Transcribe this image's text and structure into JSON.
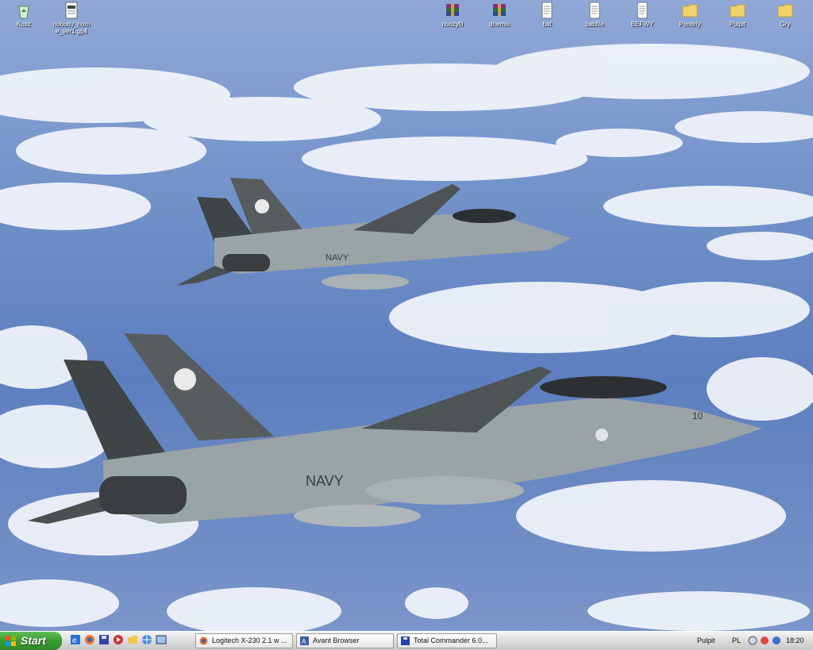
{
  "desktop": {
    "icons_left": [
      {
        "label": "Kosz",
        "icon": "recycle-bin-icon"
      },
      {
        "label": "nobody_hom e_ver1.gp4",
        "icon": "document-icon"
      }
    ],
    "icons_right": [
      {
        "label": "noozyfil",
        "icon": "winrar-archive-icon"
      },
      {
        "label": "dhemis",
        "icon": "winrar-archive-icon"
      },
      {
        "label": "bat",
        "icon": "text-file-icon"
      },
      {
        "label": "babfile",
        "icon": "text-file-icon"
      },
      {
        "label": "BEFWY",
        "icon": "text-file-icon"
      },
      {
        "label": "Pendrly",
        "icon": "folder-icon"
      },
      {
        "label": "Pulpit",
        "icon": "folder-icon"
      },
      {
        "label": "Gry",
        "icon": "folder-icon"
      }
    ],
    "wallpaper": {
      "jet_top": {
        "tail_text": "NAVY"
      },
      "jet_bottom": {
        "tail_text": "NAVY",
        "side_number": "10"
      }
    }
  },
  "taskbar": {
    "start_label": "Start",
    "quick_launch": [
      "ie-icon",
      "firefox-icon",
      "save-icon",
      "media-icon",
      "folder-icon",
      "network-icon",
      "window-icon"
    ],
    "tasks": [
      {
        "label": "Logitech X-230 2.1 w ...",
        "icon": "firefox-icon"
      },
      {
        "label": "Avant Browser",
        "icon": "browser-icon"
      },
      {
        "label": "Total Commander 6.0...",
        "icon": "disk-icon"
      }
    ],
    "tray": {
      "toolbar_label": "Pulpit",
      "language": "PL",
      "clock": "18:20"
    }
  },
  "colors": {
    "sky": "#6f8fc8",
    "start_green": "#3a9b33",
    "jet_grey": "#9aa3a6",
    "jet_dark": "#4a4f52"
  }
}
